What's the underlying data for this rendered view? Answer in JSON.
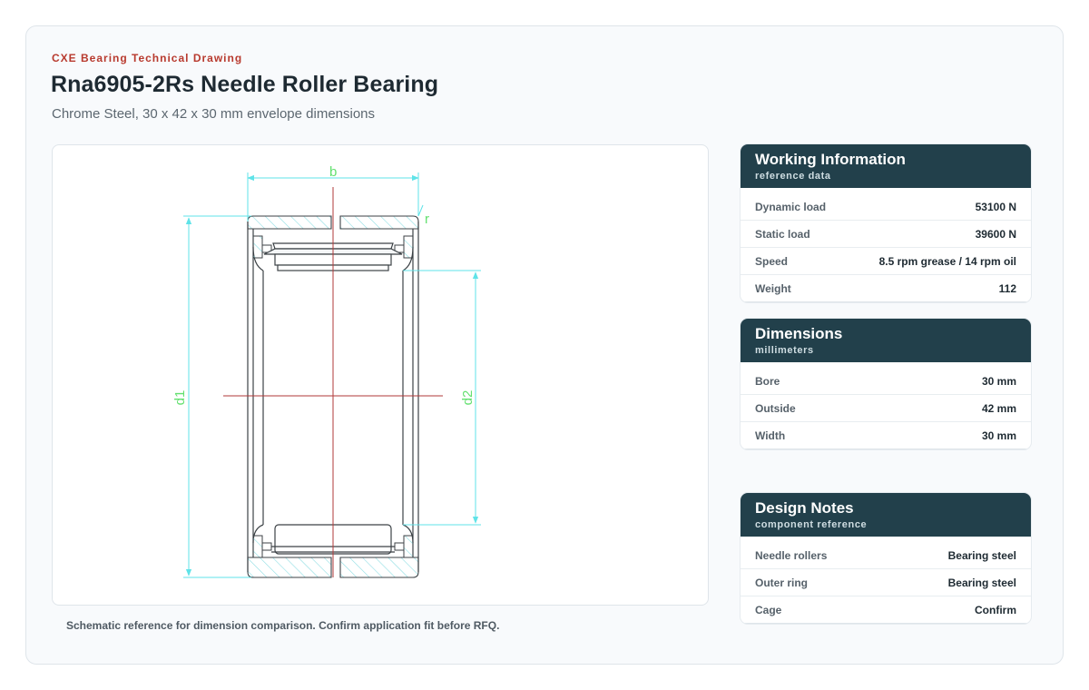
{
  "header": {
    "eyebrow": "CXE Bearing Technical Drawing",
    "title": "Rna6905-2Rs Needle Roller Bearing",
    "subtitle": "Chrome Steel, 30 x 42 x 30 mm envelope dimensions"
  },
  "drawing": {
    "labels": {
      "width": "b",
      "radius": "r",
      "outer_diameter": "d1",
      "inner_diameter": "d2"
    },
    "colors": {
      "dimension": "#5fe3e8",
      "label": "#63e06f",
      "centerline": "#b23a3a",
      "outline": "#3c4246",
      "hatch": "#7fd9e0"
    }
  },
  "caption": "Schematic reference for dimension comparison. Confirm application fit before RFQ.",
  "panels": [
    {
      "title": "Working Information",
      "subtitle": "reference data",
      "rows": [
        {
          "label": "Dynamic load",
          "value": "53100 N"
        },
        {
          "label": "Static load",
          "value": "39600 N"
        },
        {
          "label": "Speed",
          "value": "8.5 rpm grease / 14 rpm oil"
        },
        {
          "label": "Weight",
          "value": "112"
        }
      ]
    },
    {
      "title": "Dimensions",
      "subtitle": "millimeters",
      "rows": [
        {
          "label": "Bore",
          "value": "30 mm"
        },
        {
          "label": "Outside",
          "value": "42 mm"
        },
        {
          "label": "Width",
          "value": "30 mm"
        }
      ]
    },
    {
      "title": "Design Notes",
      "subtitle": "component reference",
      "rows": [
        {
          "label": "Needle rollers",
          "value": "Bearing steel"
        },
        {
          "label": "Outer ring",
          "value": "Bearing steel"
        },
        {
          "label": "Cage",
          "value": "Confirm"
        }
      ]
    }
  ]
}
